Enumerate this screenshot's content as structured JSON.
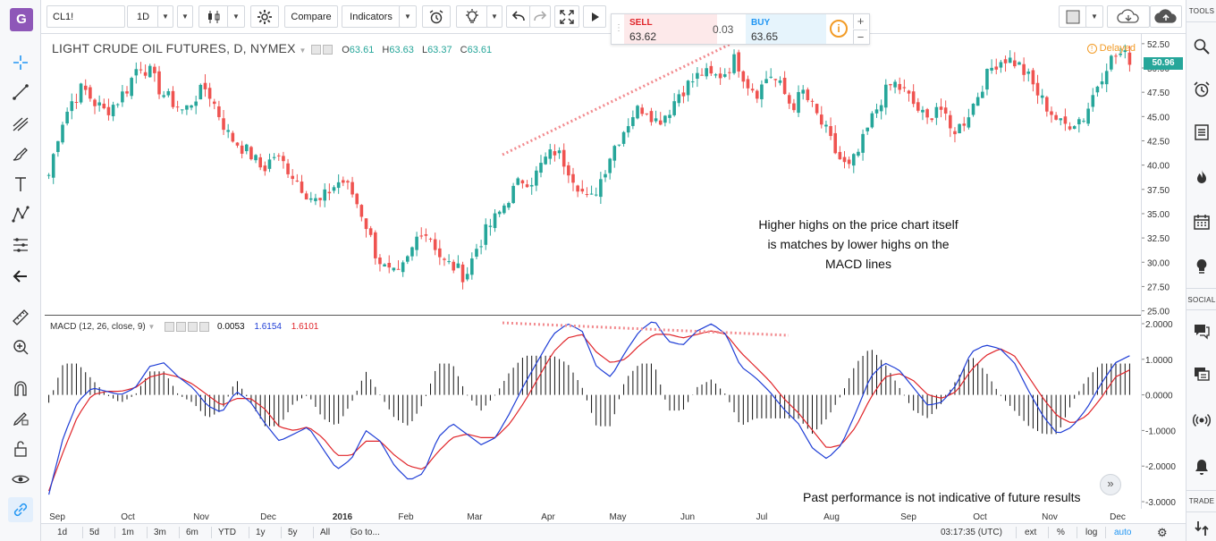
{
  "app": {
    "logo_letter": "G"
  },
  "left_toolbar": {
    "tools": [
      "crosshair-icon",
      "trend-line-icon",
      "pitchfork-icon",
      "brush-icon",
      "text-icon",
      "pattern-icon",
      "prediction-icon",
      "back-arrow-icon",
      "ruler-icon",
      "zoom-in-icon",
      "magnet-icon",
      "lock-drawing-icon",
      "unlock-icon",
      "eye-icon",
      "link-icon"
    ]
  },
  "top_toolbar": {
    "symbol": "CL1!",
    "interval": "1D",
    "compare_label": "Compare",
    "indicators_label": "Indicators"
  },
  "quote": {
    "sell_label": "SELL",
    "sell_price": "63.62",
    "spread": "0.03",
    "buy_label": "BUY",
    "buy_price": "63.65",
    "info": "i",
    "plus": "+",
    "minus": "−",
    "colors": {
      "sell": "#e0252a",
      "buy": "#2196f3"
    }
  },
  "price_legend": {
    "title": "LIGHT CRUDE OIL FUTURES, D, NYMEX",
    "open_key": "O",
    "open": "63.61",
    "high_key": "H",
    "high": "63.63",
    "low_key": "L",
    "low": "63.37",
    "close_key": "C",
    "close": "63.61"
  },
  "delayed_label": "Delayed",
  "last_price_label": "50.96",
  "macd_legend": {
    "title": "MACD (12, 26, close, 9)",
    "hist": "0.0053",
    "macd": "1.6154",
    "signal": "1.6101"
  },
  "annotation": {
    "line1": "Higher highs on the price chart itself",
    "line2": "is matches by lower highs on the",
    "line3": "MACD lines"
  },
  "disclaimer": "Past performance is not indicative of future results",
  "right_sidebar": {
    "tools_label": "TOOLS",
    "social_label": "SOCIAL",
    "trade_label": "TRADE"
  },
  "bottom_bar": {
    "ranges": [
      "1d",
      "5d",
      "1m",
      "3m",
      "6m",
      "YTD",
      "1y",
      "5y",
      "All"
    ],
    "goto": "Go to...",
    "time": "03:17:35 (UTC)",
    "ext": "ext",
    "pct": "%",
    "log": "log",
    "auto": "auto"
  },
  "chart_data": [
    {
      "type": "candlestick",
      "title": "LIGHT CRUDE OIL FUTURES, D, NYMEX",
      "x_labels": [
        "Sep",
        "Oct",
        "Nov",
        "Dec",
        "2016",
        "Feb",
        "Mar",
        "Apr",
        "May",
        "Jun",
        "Jul",
        "Aug",
        "Sep",
        "Oct",
        "Nov",
        "Dec"
      ],
      "y_ticks": [
        25.0,
        27.5,
        30.0,
        32.5,
        35.0,
        37.5,
        40.0,
        42.5,
        45.0,
        47.5,
        50.0,
        52.5
      ],
      "ylim": [
        24.5,
        53.5
      ],
      "close_path": [
        39.0,
        44.0,
        46.5,
        48.0,
        46.5,
        45.5,
        46.5,
        48.0,
        50.5,
        49.5,
        47.5,
        46.5,
        45.5,
        47.0,
        48.0,
        45.5,
        43.0,
        42.0,
        41.0,
        39.5,
        41.0,
        40.0,
        38.5,
        37.0,
        36.0,
        37.5,
        38.5,
        37.0,
        34.5,
        31.0,
        29.0,
        28.5,
        30.5,
        33.5,
        32.5,
        30.0,
        29.5,
        28.5,
        31.5,
        33.5,
        35.0,
        37.0,
        38.5,
        38.5,
        40.5,
        41.5,
        40.0,
        38.0,
        36.0,
        38.5,
        41.5,
        43.5,
        45.5,
        46.0,
        44.5,
        45.5,
        47.5,
        48.5,
        49.5,
        49.0,
        49.5,
        51.0,
        48.5,
        47.5,
        49.5,
        48.0,
        46.0,
        47.5,
        45.5,
        43.5,
        41.0,
        39.5,
        41.5,
        44.5,
        47.0,
        48.5,
        47.5,
        46.0,
        44.5,
        46.5,
        43.5,
        44.0,
        46.0,
        48.5,
        50.5,
        51.0,
        50.5,
        49.0,
        47.0,
        45.5,
        44.0,
        44.5,
        45.0,
        48.0,
        50.5,
        51.5,
        50.96
      ],
      "series": [
        {
          "name": "CL1!",
          "close": "close_path"
        }
      ],
      "up_color": "#26a69a",
      "down_color": "#ef5350"
    },
    {
      "type": "line",
      "title": "MACD (12, 26, close, 9)",
      "x_labels": [
        "Sep",
        "Oct",
        "Nov",
        "Dec",
        "2016",
        "Feb",
        "Mar",
        "Apr",
        "May",
        "Jun",
        "Jul",
        "Aug",
        "Sep",
        "Oct",
        "Nov",
        "Dec"
      ],
      "y_ticks": [
        2.0,
        1.0,
        0.0,
        -1.0,
        -2.0,
        -3.0
      ],
      "y_tick_labels": [
        "2.0000",
        "1.0000",
        "0.0000",
        "-1.0000",
        "-2.0000",
        "-3.0000"
      ],
      "ylim": [
        -3.2,
        2.2
      ],
      "series": [
        {
          "name": "MACD",
          "color": "#1f3ed6",
          "values": [
            -2.8,
            -1.2,
            -0.2,
            0.2,
            0.1,
            0.0,
            0.2,
            0.8,
            0.9,
            0.5,
            0.2,
            -0.3,
            -0.5,
            0.1,
            -0.2,
            -0.8,
            -1.3,
            -1.1,
            -0.9,
            -1.5,
            -2.1,
            -1.8,
            -1.0,
            -1.3,
            -2.0,
            -2.4,
            -2.2,
            -1.2,
            -0.8,
            -1.1,
            -1.4,
            -1.2,
            -0.5,
            0.3,
            1.0,
            1.7,
            2.0,
            1.8,
            0.8,
            0.5,
            1.2,
            1.8,
            2.1,
            1.5,
            1.4,
            1.8,
            2.0,
            1.7,
            0.8,
            0.5,
            0.1,
            -0.4,
            -0.8,
            -1.5,
            -1.8,
            -1.4,
            -0.5,
            0.5,
            0.9,
            0.7,
            0.2,
            -0.3,
            -0.2,
            0.3,
            1.2,
            1.4,
            1.3,
            0.9,
            0.1,
            -0.6,
            -1.1,
            -0.9,
            -0.4,
            0.3,
            0.9,
            1.1
          ]
        },
        {
          "name": "Signal",
          "color": "#e0252a",
          "values": [
            -2.7,
            -1.6,
            -0.6,
            0.0,
            0.1,
            0.1,
            0.2,
            0.5,
            0.6,
            0.5,
            0.3,
            0.0,
            -0.3,
            -0.1,
            -0.1,
            -0.4,
            -0.9,
            -1.0,
            -0.9,
            -1.2,
            -1.7,
            -1.7,
            -1.3,
            -1.3,
            -1.7,
            -2.0,
            -2.1,
            -1.6,
            -1.2,
            -1.1,
            -1.2,
            -1.2,
            -0.8,
            -0.2,
            0.5,
            1.2,
            1.6,
            1.7,
            1.2,
            0.9,
            1.0,
            1.4,
            1.7,
            1.7,
            1.6,
            1.7,
            1.8,
            1.7,
            1.2,
            0.8,
            0.4,
            -0.1,
            -0.5,
            -1.0,
            -1.5,
            -1.4,
            -0.9,
            -0.1,
            0.5,
            0.6,
            0.4,
            0.0,
            -0.1,
            0.1,
            0.7,
            1.1,
            1.3,
            1.1,
            0.5,
            -0.1,
            -0.6,
            -0.8,
            -0.6,
            -0.1,
            0.5,
            0.7
          ]
        }
      ],
      "histogram_color": "#111111"
    }
  ]
}
